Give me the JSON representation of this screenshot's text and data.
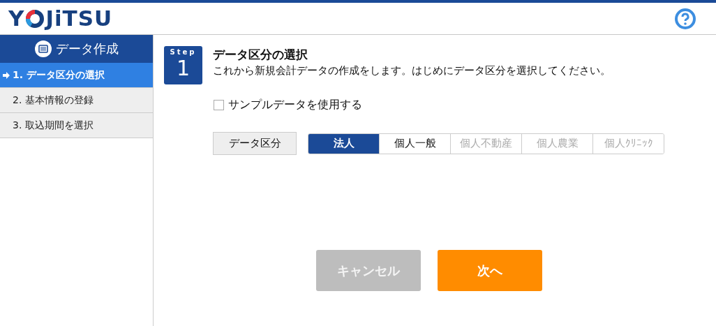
{
  "header": {
    "logo_start": "Y",
    "logo_end": "JiTSU"
  },
  "sidebar": {
    "title": "データ作成",
    "items": [
      {
        "label": "1. データ区分の選択",
        "selected": true
      },
      {
        "label": "2. 基本情報の登録",
        "selected": false
      },
      {
        "label": "3. 取込期間を選択",
        "selected": false
      }
    ]
  },
  "step": {
    "label": "Step",
    "number": "1"
  },
  "title": "データ区分の選択",
  "description": "これから新規会計データの作成をします。はじめにデータ区分を選択してください。",
  "sample_checkbox": {
    "label": "サンプルデータを使用する",
    "checked": false
  },
  "category": {
    "label": "データ区分",
    "options": [
      {
        "label": "法人",
        "selected": true,
        "disabled": false
      },
      {
        "label": "個人一般",
        "selected": false,
        "disabled": false
      },
      {
        "label": "個人不動産",
        "selected": false,
        "disabled": true
      },
      {
        "label": "個人農業",
        "selected": false,
        "disabled": true
      },
      {
        "label": "個人ｸﾘﾆｯｸ",
        "selected": false,
        "disabled": true
      }
    ]
  },
  "buttons": [
    {
      "label": "キャンセル",
      "kind": "cancel",
      "disabled": true
    },
    {
      "label": "次へ",
      "kind": "primary",
      "disabled": false
    }
  ]
}
